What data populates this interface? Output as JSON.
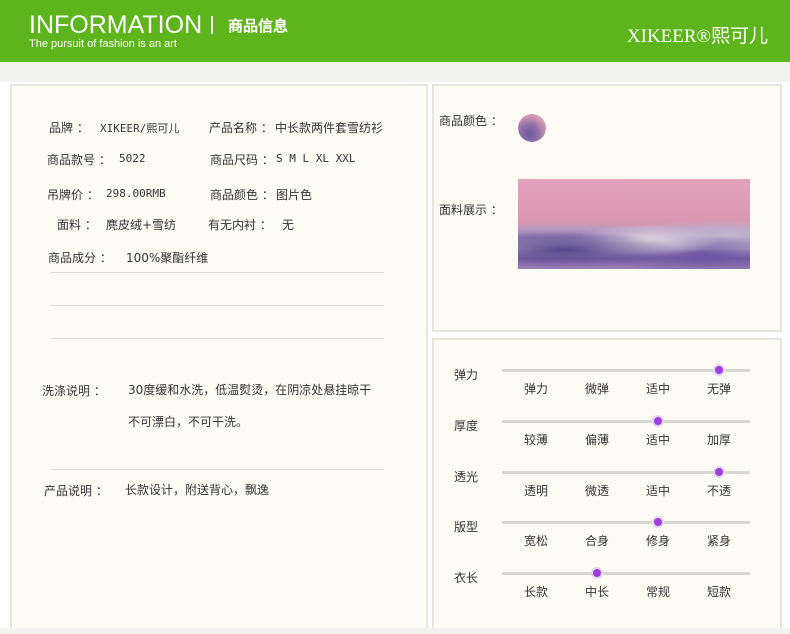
{
  "header": {
    "title": "INFORMATION",
    "subtitle": "The pursuit of fashion is an art",
    "section_cn": "商品信息",
    "brand": "XIKEER®熙可儿",
    "bg_color": "#5eb51b"
  },
  "details": {
    "brand_label": "品牌 ：",
    "brand_value": "XIKEER/熙可儿",
    "name_label": "产品名称 ：",
    "name_value": "中长款两件套雪纺衫",
    "style_label": "商品款号 ：",
    "style_value": "5022",
    "size_label": "商品尺码 ：",
    "size_value": "S M L XL XXL",
    "price_label": "吊牌价 ：",
    "price_value": "298.00RMB",
    "color_label": "商品颜色 ：",
    "color_value": "图片色",
    "fabric_label": "面料 ：",
    "fabric_value": "麂皮绒+雪纺",
    "lining_label": "有无内衬 ：",
    "lining_value": "无",
    "composition_label": "商品成分 ：",
    "composition_value": "100%聚酯纤维",
    "wash_label": "洗涤说明 ：",
    "wash_line1": "30度缓和水洗，低温熨烫，在阴凉处悬挂晾干",
    "wash_line2": "不可漂白，不可干洗。",
    "desc_label": "产品说明 ：",
    "desc_value": "长款设计，附送背心，飘逸"
  },
  "swatches": {
    "color_label": "商品颜色 ：",
    "fabric_label": "面料展示 ："
  },
  "ratings": [
    {
      "label": "弹力",
      "options": [
        "弹力",
        "微弹",
        "适中",
        "无弹"
      ],
      "selected_index": 3
    },
    {
      "label": "厚度",
      "options": [
        "较薄",
        "偏薄",
        "适中",
        "加厚"
      ],
      "selected_index": 2
    },
    {
      "label": "透光",
      "options": [
        "透明",
        "微透",
        "适中",
        "不透"
      ],
      "selected_index": 3
    },
    {
      "label": "版型",
      "options": [
        "宽松",
        "合身",
        "修身",
        "紧身"
      ],
      "selected_index": 2
    },
    {
      "label": "衣长",
      "options": [
        "长款",
        "中长",
        "常规",
        "短款"
      ],
      "selected_index": 1
    }
  ],
  "colors": {
    "accent": "#9b3fe0",
    "panel_bg": "#fdfcf4"
  }
}
